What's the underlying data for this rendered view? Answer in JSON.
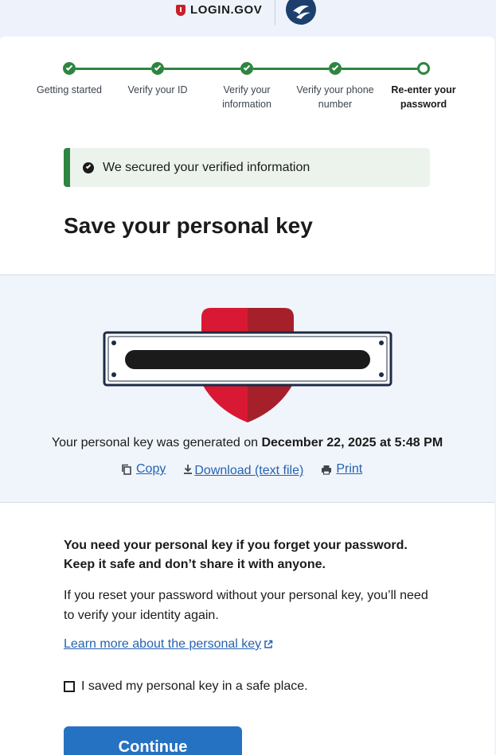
{
  "header": {
    "logo_text": "LOGIN.GOV",
    "agency_icon": "dot-agency-seal-icon"
  },
  "steps": [
    {
      "label": "Getting started",
      "status": "complete"
    },
    {
      "label": "Verify your ID",
      "status": "complete"
    },
    {
      "label": "Verify your information",
      "status": "complete"
    },
    {
      "label": "Verify your phone number",
      "status": "complete"
    },
    {
      "label": "Re-enter your password",
      "status": "current"
    }
  ],
  "alert": {
    "icon": "check-circle-icon",
    "text": "We secured your verified information"
  },
  "page_title": "Save your personal key",
  "personal_key": {
    "graphic_icon": "shield-key-icon",
    "generated_prefix": "Your personal key was generated on ",
    "generated_date": "December 22, 2025 at 5:48 PM"
  },
  "actions": {
    "copy_label": "Copy",
    "download_label": "Download (text file)",
    "print_label": "Print"
  },
  "notice": {
    "strong": "You need your personal key if you forget your password. Keep it safe and don’t share it with anyone.",
    "body": "If you reset your password without your personal key, you’ll need to verify your identity again.",
    "learn_more": "Learn more about the personal key"
  },
  "acknowledgment": {
    "label": "I saved my personal key in a safe place.",
    "checked": false
  },
  "continue_label": "Continue",
  "colors": {
    "success": "#2e8540",
    "link": "#2662b0",
    "primary_button": "#2672c2",
    "shield_red": "#d91833"
  }
}
